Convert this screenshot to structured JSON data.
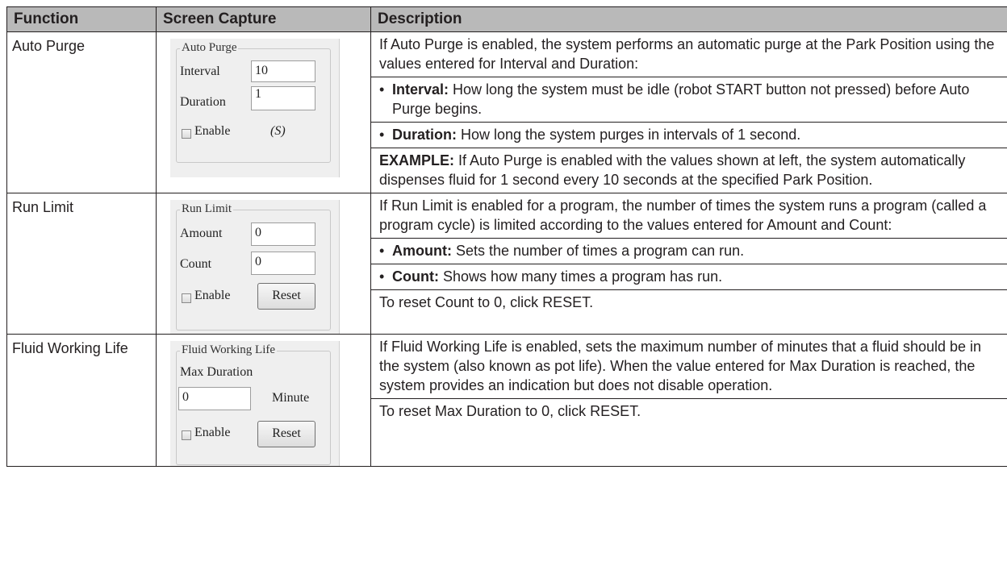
{
  "headers": {
    "function": "Function",
    "capture": "Screen Capture",
    "description": "Description"
  },
  "rows": [
    {
      "function": "Auto Purge",
      "capture": {
        "title": "Auto Purge",
        "field1_label": "Interval",
        "field1_value": "10",
        "field2_label": "Duration",
        "field2_value": "1",
        "checkbox_label": "Enable",
        "unit": "(S)"
      },
      "desc": {
        "intro": "If Auto Purge is enabled, the system performs an automatic purge at the Park Position using the values entered for Interval and Duration:",
        "b1_term": "Interval:",
        "b1_text": " How long the system must be idle (robot START button not pressed) before Auto Purge begins.",
        "b2_term": "Duration:",
        "b2_text": " How long the system purges in intervals of 1 second.",
        "ex_term": "EXAMPLE:",
        "ex_text": " If Auto Purge is enabled with the values shown at left, the system automatically dispenses fluid for 1 second every 10 seconds at the specified Park Position."
      }
    },
    {
      "function": "Run Limit",
      "capture": {
        "title": "Run Limit",
        "field1_label": "Amount",
        "field1_value": "0",
        "field2_label": "Count",
        "field2_value": "0",
        "checkbox_label": "Enable",
        "button": "Reset"
      },
      "desc": {
        "intro": "If Run Limit is enabled for a program, the number of times the system runs a program (called a program cycle) is limited according to the values entered for Amount and Count:",
        "b1_term": "Amount:",
        "b1_text": " Sets the number of times a program can run.",
        "b2_term": "Count:",
        "b2_text": " Shows how many times a program has run.",
        "reset": "To reset Count to 0, click RESET."
      }
    },
    {
      "function": "Fluid Working Life",
      "capture": {
        "title": "Fluid Working Life",
        "label": "Max Duration",
        "field_value": "0",
        "unit": "Minute",
        "checkbox_label": "Enable",
        "button": "Reset"
      },
      "desc": {
        "intro": "If Fluid Working Life is enabled, sets the maximum number of minutes that a fluid should be in the system (also known as pot life). When the value entered for Max Duration is reached, the system provides an indication but does not disable operation.",
        "reset": "To reset Max Duration to 0, click RESET."
      }
    }
  ]
}
